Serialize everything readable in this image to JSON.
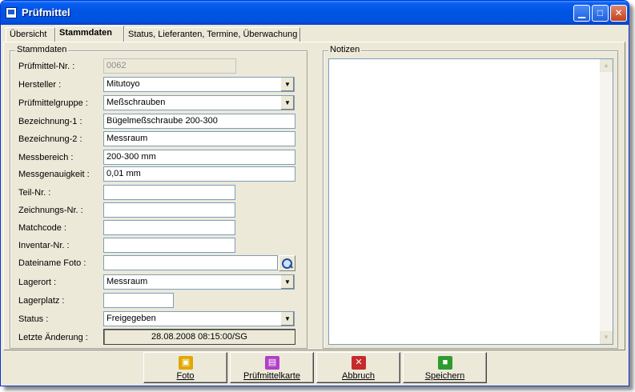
{
  "window": {
    "title": "Prüfmittel"
  },
  "tabs": [
    {
      "label": "Übersicht"
    },
    {
      "label": "Stammdaten"
    },
    {
      "label": "Status, Lieferanten, Termine, Überwachung"
    }
  ],
  "stammdaten": {
    "group_label": "Stammdaten",
    "fields": {
      "pruefmittel_nr": {
        "label": "Prüfmittel-Nr. :",
        "value": "0062"
      },
      "hersteller": {
        "label": "Hersteller :",
        "value": "Mitutoyo"
      },
      "pruefmittelgruppe": {
        "label": "Prüfmittelgruppe :",
        "value": "Meßschrauben"
      },
      "bezeichnung1": {
        "label": "Bezeichnung-1 :",
        "value": "Bügelmeßschraube 200-300"
      },
      "bezeichnung2": {
        "label": "Bezeichnung-2 :",
        "value": "Messraum"
      },
      "messbereich": {
        "label": "Messbereich :",
        "value": "200-300 mm"
      },
      "messgenauigkeit": {
        "label": "Messgenauigkeit :",
        "value": "0,01 mm"
      },
      "teil_nr": {
        "label": "Teil-Nr. :",
        "value": ""
      },
      "zeichnungs_nr": {
        "label": "Zeichnungs-Nr. :",
        "value": ""
      },
      "matchcode": {
        "label": "Matchcode :",
        "value": ""
      },
      "inventar_nr": {
        "label": "Inventar-Nr. :",
        "value": ""
      },
      "dateiname_foto": {
        "label": "Dateiname Foto :",
        "value": ""
      },
      "lagerort": {
        "label": "Lagerort :",
        "value": "Messraum"
      },
      "lagerplatz": {
        "label": "Lagerplatz :",
        "value": ""
      },
      "status": {
        "label": "Status :",
        "value": "Freigegeben"
      },
      "letzte_aenderung": {
        "label": "Letzte Änderung :",
        "value": "28.08.2008 08:15:00/SG"
      }
    }
  },
  "notizen": {
    "group_label": "Notizen",
    "value": ""
  },
  "buttons": {
    "foto": "Foto",
    "pruefmittelkarte": "Prüfmittelkarte",
    "abbruch": "Abbruch",
    "speichern": "Speichern"
  }
}
